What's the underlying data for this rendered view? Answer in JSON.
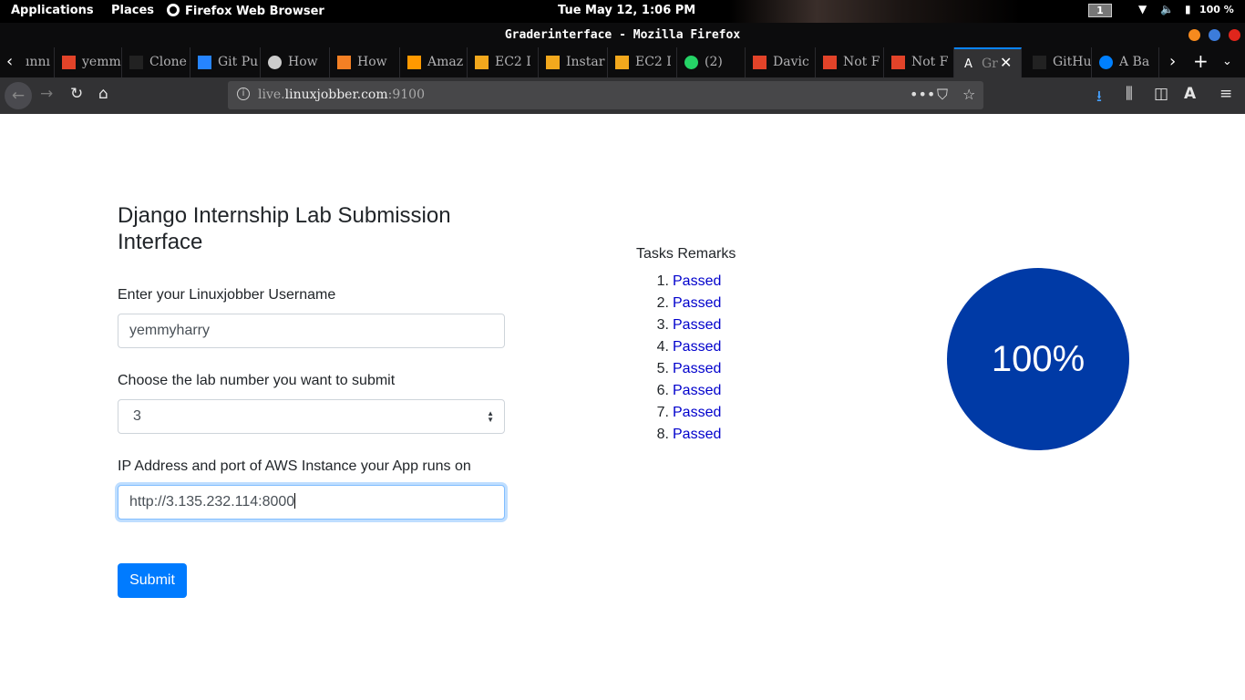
{
  "desktop": {
    "applications_label": "Applications",
    "places_label": "Places",
    "active_app_label": "Firefox Web Browser",
    "clock": "Tue May 12,  1:06 PM",
    "workspace": "1",
    "battery": "100 %"
  },
  "window": {
    "title": "Graderinterface - Mozilla Firefox"
  },
  "tabs": [
    {
      "label": "ınnı",
      "icon": "generic-icon",
      "color": "#888888"
    },
    {
      "label": "yemm",
      "icon": "gitlab-icon",
      "color": "#e24329"
    },
    {
      "label": "Clone",
      "icon": "github-icon",
      "color": "#222222"
    },
    {
      "label": "Git Pu",
      "icon": "atlassian-icon",
      "color": "#2684ff"
    },
    {
      "label": "How",
      "icon": "loading-icon",
      "color": "#cccccc"
    },
    {
      "label": "How",
      "icon": "stackoverflow-icon",
      "color": "#f48024"
    },
    {
      "label": "Amaz",
      "icon": "aws-icon",
      "color": "#ff9900"
    },
    {
      "label": "EC2 I",
      "icon": "ec2-icon",
      "color": "#f2a81d"
    },
    {
      "label": "Instar",
      "icon": "ec2-icon",
      "color": "#f2a81d"
    },
    {
      "label": "EC2 I",
      "icon": "ec2-icon",
      "color": "#f2a81d"
    },
    {
      "label": "(2)",
      "icon": "whatsapp-icon",
      "color": "#25d366"
    },
    {
      "label": "Davic",
      "icon": "gitlab-icon",
      "color": "#e24329"
    },
    {
      "label": "Not F",
      "icon": "gitlab-icon",
      "color": "#e24329"
    },
    {
      "label": "Not F",
      "icon": "gitlab-icon",
      "color": "#e24329"
    },
    {
      "label": "Gr",
      "icon": "grader-icon",
      "color": "#ffffff",
      "active": true
    },
    {
      "label": "GitHu",
      "icon": "github-icon",
      "color": "#222222"
    },
    {
      "label": "A Ba",
      "icon": "digitalocean-icon",
      "color": "#0080ff"
    }
  ],
  "navbar": {
    "url_host": "live.",
    "url_domain": "linuxjobber.com",
    "url_port": ":9100"
  },
  "form": {
    "heading": "Django Internship Lab Submission Interface",
    "username_label": "Enter your Linuxjobber Username",
    "username_value": "yemmyharry",
    "lab_label": "Choose the lab number you want to submit",
    "lab_value": "3",
    "ip_label": "IP Address and port of AWS Instance your App runs on",
    "ip_value": "http://3.135.232.114:8000",
    "submit_label": "Submit"
  },
  "remarks": {
    "title": "Tasks Remarks",
    "items": [
      {
        "num": "1.",
        "value": "Passed"
      },
      {
        "num": "2.",
        "value": "Passed"
      },
      {
        "num": "3.",
        "value": "Passed"
      },
      {
        "num": "4.",
        "value": "Passed"
      },
      {
        "num": "5.",
        "value": "Passed"
      },
      {
        "num": "6.",
        "value": "Passed"
      },
      {
        "num": "7.",
        "value": "Passed"
      },
      {
        "num": "8.",
        "value": "Passed"
      }
    ]
  },
  "score": {
    "label": "100%",
    "color": "#003aa6"
  },
  "colors": {
    "accent": "#007bff",
    "passed_link": "#0000cc"
  }
}
